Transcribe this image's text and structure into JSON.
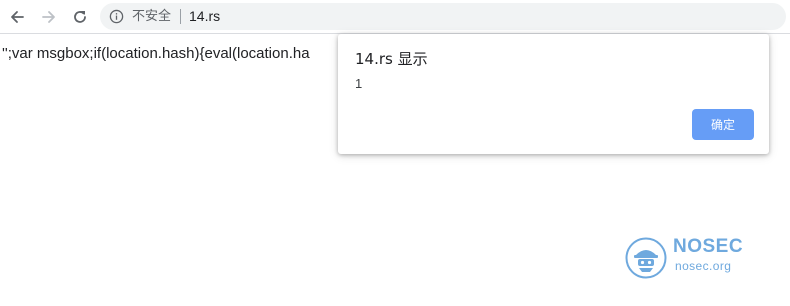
{
  "browser": {
    "security_label": "不安全",
    "url": "14.rs",
    "icons": [
      "back-arrow-icon",
      "forward-arrow-icon",
      "reload-icon",
      "info-icon"
    ]
  },
  "page": {
    "text": "'';var msgbox;if(location.hash){eval(location.ha"
  },
  "dialog": {
    "title": "14.rs 显示",
    "message": "1",
    "ok_label": "确定",
    "button_color": "#669df6"
  },
  "watermark": {
    "name": "NOSEC",
    "domain": "nosec.org",
    "color": "#6fa9de"
  }
}
